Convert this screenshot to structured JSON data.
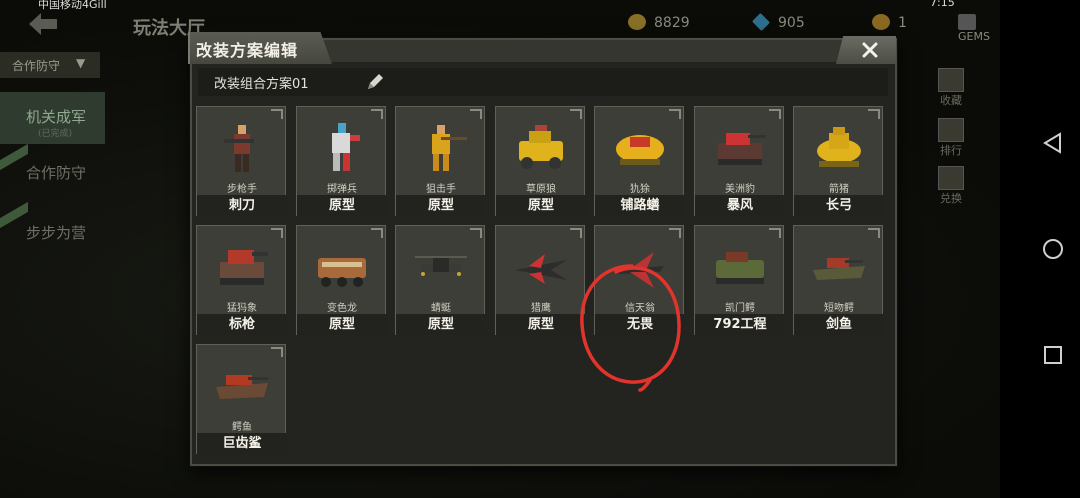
{
  "status_bar": {
    "carrier": "中国移动4Gill",
    "time": "7:15"
  },
  "header": {
    "title": "玩法大厅",
    "resources": [
      {
        "name": "gold",
        "icon": "coin-icon",
        "value": "8829",
        "color": "#a8892c"
      },
      {
        "name": "diamond",
        "icon": "diamond-icon",
        "value": "905",
        "color": "#3f7fa6"
      },
      {
        "name": "medal",
        "icon": "medal-icon",
        "value": "1",
        "color": "#a07a2a"
      },
      {
        "name": "gems",
        "icon": "plus-icon",
        "value": "GEMS",
        "color": "#777"
      }
    ]
  },
  "leftnav": {
    "mode_label": "合作防守",
    "items": [
      {
        "label": "机关成军",
        "sub": "(已完成)"
      },
      {
        "label": "合作防守"
      },
      {
        "label": "步步为营"
      }
    ]
  },
  "rightside": [
    {
      "label": "收藏",
      "icon": "archive-icon"
    },
    {
      "label": "排行",
      "icon": "trophy-icon"
    },
    {
      "label": "兑换",
      "icon": "cross-swords-icon"
    }
  ],
  "dialog": {
    "title": "改装方案编辑",
    "plan_name": "改装组合方案01",
    "units": [
      {
        "unit": "步枪手",
        "plan": "刺刀",
        "art": "rifleman"
      },
      {
        "unit": "掷弹兵",
        "plan": "原型",
        "art": "grenadier"
      },
      {
        "unit": "狙击手",
        "plan": "原型",
        "art": "sniper"
      },
      {
        "unit": "草原狼",
        "plan": "原型",
        "art": "jeep"
      },
      {
        "unit": "犰狳",
        "plan": "铺路蟮",
        "art": "armadillo"
      },
      {
        "unit": "美洲豹",
        "plan": "暴风",
        "art": "jaguar"
      },
      {
        "unit": "箭猪",
        "plan": "长弓",
        "art": "porcupine"
      },
      {
        "unit": "猛犸象",
        "plan": "标枪",
        "art": "mammoth"
      },
      {
        "unit": "变色龙",
        "plan": "原型",
        "art": "chameleon"
      },
      {
        "unit": "蜻蜓",
        "plan": "原型",
        "art": "dragonfly"
      },
      {
        "unit": "猎鹰",
        "plan": "原型",
        "art": "falcon"
      },
      {
        "unit": "信天翁",
        "plan": "无畏",
        "art": "albatross"
      },
      {
        "unit": "凯门鳄",
        "plan": "792工程",
        "art": "caiman"
      },
      {
        "unit": "短吻鳄",
        "plan": "剑鱼",
        "art": "alligator"
      },
      {
        "unit": "鳄鱼",
        "plan": "巨齿鲨",
        "art": "crocodile"
      }
    ]
  }
}
